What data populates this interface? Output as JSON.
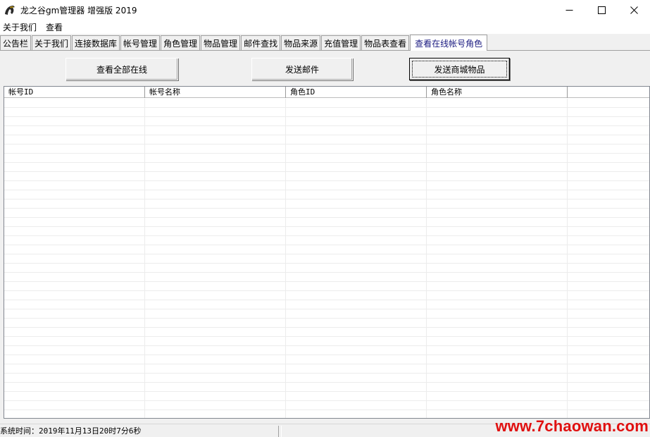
{
  "window": {
    "title": "龙之谷gm管理器 增强版  2019",
    "icon": "dragon-app-icon",
    "controls": [
      "minimize-icon",
      "maximize-icon",
      "close-icon"
    ]
  },
  "menu": {
    "items": [
      {
        "label": "关于我们"
      },
      {
        "label": "查看"
      }
    ]
  },
  "tabs": [
    {
      "label": "公告栏"
    },
    {
      "label": "关于我们"
    },
    {
      "label": "连接数据库"
    },
    {
      "label": "帐号管理"
    },
    {
      "label": "角色管理"
    },
    {
      "label": "物品管理"
    },
    {
      "label": "邮件查找"
    },
    {
      "label": "物品来源"
    },
    {
      "label": "充值管理"
    },
    {
      "label": "物品表查看"
    },
    {
      "label": "查看在线帐号角色",
      "active": true
    }
  ],
  "toolbar": {
    "view_all_online_label": "查看全部在线",
    "send_mail_label": "发送邮件",
    "send_mall_items_label": "发送商城物品"
  },
  "table": {
    "columns": [
      "帐号ID",
      "帐号名称",
      "角色ID",
      "角色名称",
      ""
    ],
    "rows": []
  },
  "status": {
    "system_time": "系统时间：2019年11月13日20时7分6秒",
    "pane2": ""
  },
  "watermark": {
    "text": "www.7chaowan.com",
    "color": "#e01010"
  },
  "colors": {
    "active_tab_text": "#1a1a80",
    "window_bg": "#f0f0f0"
  }
}
